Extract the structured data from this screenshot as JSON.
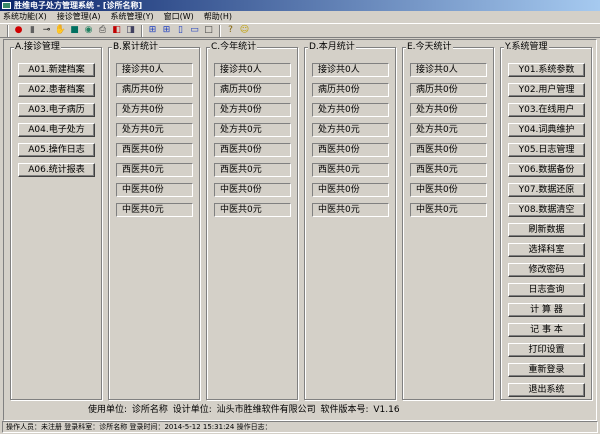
{
  "window": {
    "title": "胜维电子处方管理系统 - [诊所名称]"
  },
  "menu": [
    "系统功能(X)",
    "接诊管理(A)",
    "系统管理(Y)",
    "窗口(W)",
    "帮助(H)"
  ],
  "toolbar": {
    "group1": [
      {
        "icon": "stop-icon",
        "glyph": "●",
        "color": "#d00000"
      },
      {
        "icon": "trash-icon",
        "glyph": "▮",
        "color": "#606060"
      },
      {
        "icon": "key-icon",
        "glyph": "⊸",
        "color": "#000"
      },
      {
        "icon": "hand-icon",
        "glyph": "✋",
        "color": "#806020"
      },
      {
        "icon": "book-icon",
        "glyph": "■",
        "color": "#007060"
      },
      {
        "icon": "globe-icon",
        "glyph": "◉",
        "color": "#208060"
      },
      {
        "icon": "printer-icon",
        "glyph": "⎙",
        "color": "#404040"
      },
      {
        "icon": "export-icon",
        "glyph": "◧",
        "color": "#c00000"
      },
      {
        "icon": "exit-icon",
        "glyph": "◨",
        "color": "#404060"
      }
    ],
    "group2": [
      {
        "icon": "cascade-icon",
        "glyph": "⊞",
        "color": "#2040c0"
      },
      {
        "icon": "tile-icon",
        "glyph": "⊞",
        "color": "#2040c0"
      },
      {
        "icon": "tile-vertical-icon",
        "glyph": "▯",
        "color": "#2040c0"
      },
      {
        "icon": "tile-horizontal-icon",
        "glyph": "▭",
        "color": "#2040c0"
      },
      {
        "icon": "window-icon",
        "glyph": "□",
        "color": "#404040"
      }
    ],
    "group3": [
      {
        "icon": "help-icon",
        "glyph": "?",
        "color": "#806000"
      },
      {
        "icon": "smiley-icon",
        "glyph": "☺",
        "color": "#c0a000"
      }
    ]
  },
  "groups": [
    {
      "title": "A.接诊管理",
      "type": "btn",
      "items": [
        "A01.新建档案",
        "A02.患者档案",
        "A03.电子病历",
        "A04.电子处方",
        "A05.操作日志",
        "A06.统计报表"
      ]
    },
    {
      "title": "B.累计统计",
      "type": "lbl",
      "items": [
        "接诊共0人",
        "病历共0份",
        "处方共0份",
        "处方共0元",
        "西医共0份",
        "西医共0元",
        "中医共0份",
        "中医共0元"
      ]
    },
    {
      "title": "C.今年统计",
      "type": "lbl",
      "items": [
        "接诊共0人",
        "病历共0份",
        "处方共0份",
        "处方共0元",
        "西医共0份",
        "西医共0元",
        "中医共0份",
        "中医共0元"
      ]
    },
    {
      "title": "D.本月统计",
      "type": "lbl",
      "items": [
        "接诊共0人",
        "病历共0份",
        "处方共0份",
        "处方共0元",
        "西医共0份",
        "西医共0元",
        "中医共0份",
        "中医共0元"
      ]
    },
    {
      "title": "E.今天统计",
      "type": "lbl",
      "items": [
        "接诊共0人",
        "病历共0份",
        "处方共0份",
        "处方共0元",
        "西医共0份",
        "西医共0元",
        "中医共0份",
        "中医共0元"
      ]
    },
    {
      "title": "Y.系统管理",
      "type": "btn",
      "items": [
        "Y01.系统参数",
        "Y02.用户管理",
        "Y03.在线用户",
        "Y04.词典维护",
        "Y05.日志管理",
        "Y06.数据备份",
        "Y07.数据还原",
        "Y08.数据清空",
        "刷新数据",
        "选择科室",
        "修改密码",
        "日志查询",
        "计 算 器",
        "记 事 本",
        "打印设置",
        "重新登录",
        "退出系统"
      ]
    }
  ],
  "footer": "使用单位: 诊所名称  设计单位: 汕头市胜维软件有限公司  软件版本号: V1.16",
  "status": "操作人员：未注册 登录科室：诊所名称 登录时间：2014-5-12 15:31:24 操作日志："
}
